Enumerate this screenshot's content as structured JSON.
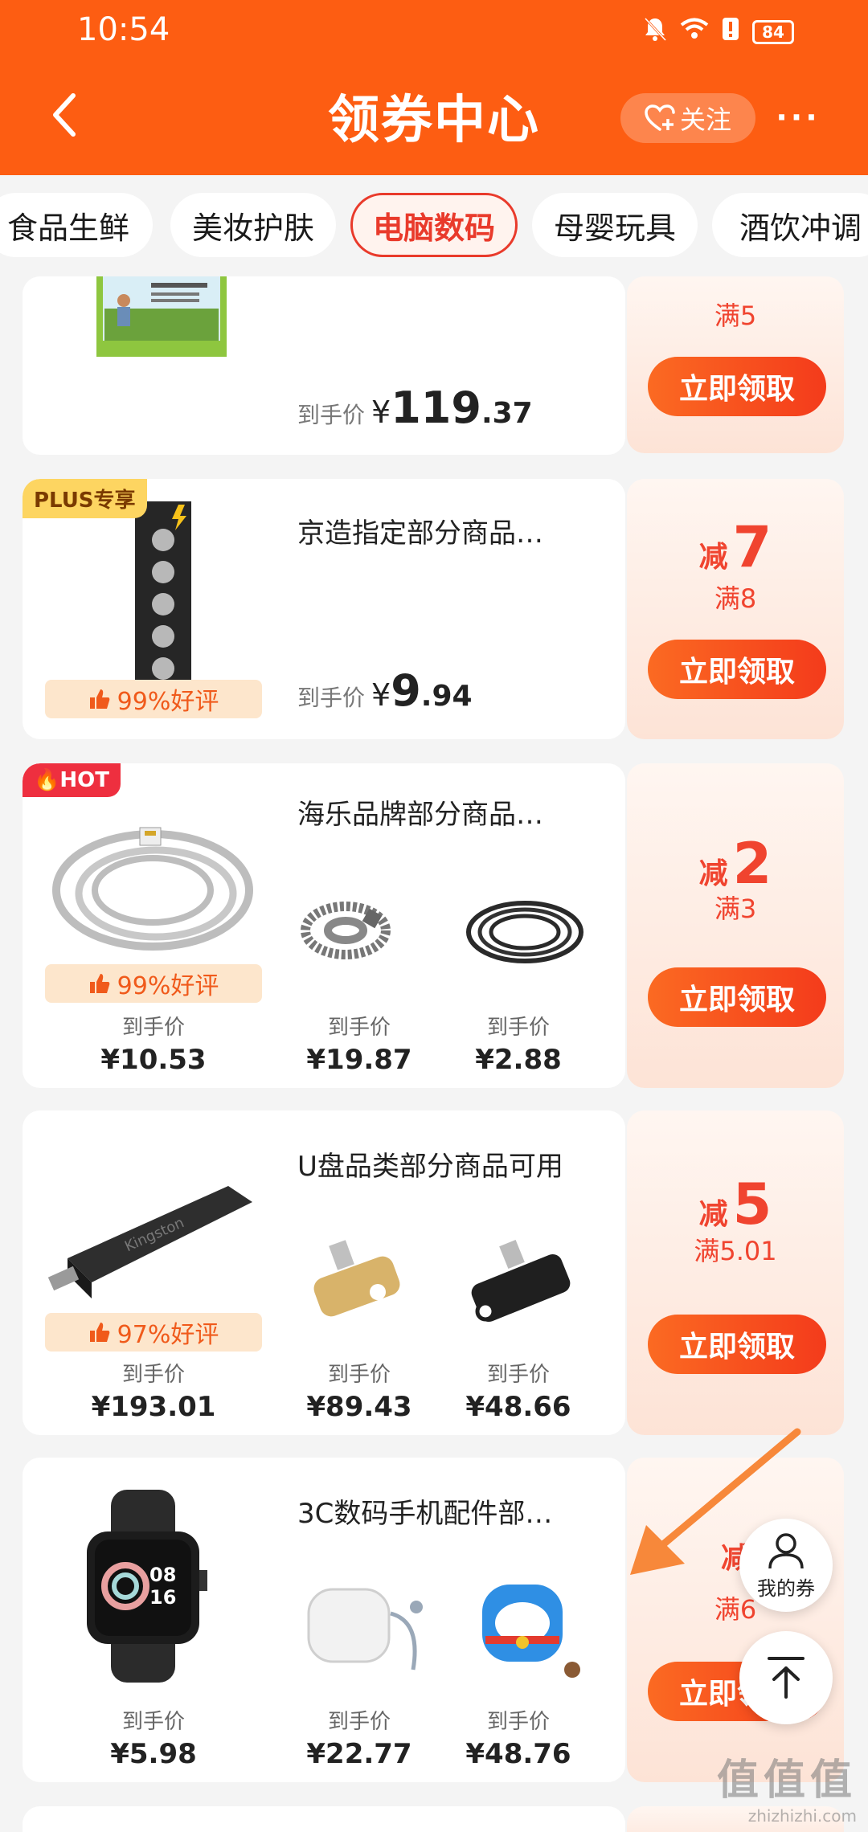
{
  "status_bar": {
    "time": "10:54",
    "battery": "84"
  },
  "header": {
    "title": "领券中心",
    "follow_label": "关注",
    "more_label": "···"
  },
  "tabs": [
    "食品生鲜",
    "美妆护肤",
    "电脑数码",
    "母婴玩具",
    "酒饮冲调"
  ],
  "common": {
    "final_price_label": "到手价",
    "claim_label": "立即领取",
    "reduce_prefix": "减",
    "min_prefix": "满"
  },
  "cards": [
    {
      "price": {
        "int": "119",
        "dec": ".37"
      },
      "coupon": {
        "min": "满5"
      }
    },
    {
      "badge": "PLUS专享",
      "title": "京造指定部分商品…",
      "rating": "99%好评",
      "price": {
        "int": "9",
        "dec": ".94"
      },
      "coupon": {
        "amount": "7",
        "min": "满8"
      }
    },
    {
      "badge": "HOT",
      "title": "海乐品牌部分商品…",
      "rating": "99%好评",
      "prices": [
        "¥10.53",
        "¥19.87",
        "¥2.88"
      ],
      "coupon": {
        "amount": "2",
        "min": "满3"
      }
    },
    {
      "title": "U盘品类部分商品可用",
      "rating": "97%好评",
      "prices": [
        "¥193.01",
        "¥89.43",
        "¥48.66"
      ],
      "coupon": {
        "amount": "5",
        "min": "满5.01"
      }
    },
    {
      "title": "3C数码手机配件部…",
      "prices": [
        "¥5.98",
        "¥22.77",
        "¥48.76"
      ],
      "coupon": {
        "min": "满6"
      }
    }
  ],
  "floating": {
    "my_coupons_label": "我的券"
  },
  "watermark": {
    "logo": "值值值",
    "url": "zhizhizhi.com"
  },
  "colors": {
    "brand": "#fd5d12",
    "accent": "#f0442f",
    "rating_bg": "#fde6cc"
  }
}
